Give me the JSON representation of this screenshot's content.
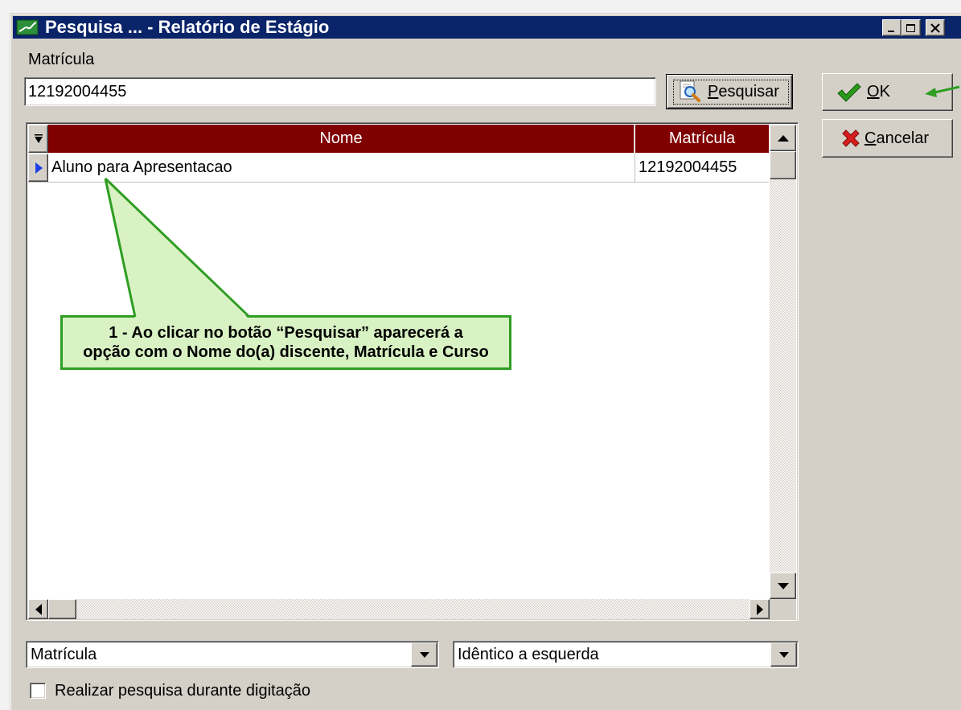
{
  "window": {
    "title": "Pesquisa ... - Relatório de Estágio",
    "icon": "app-icon",
    "controls": [
      "minimize-icon",
      "maximize-icon",
      "close-icon"
    ],
    "title_bar_color": "#0a246a"
  },
  "search": {
    "label": "Matrícula",
    "value": "12192004455",
    "button_label": "Pesquisar",
    "button_icon": "magnifier-icon"
  },
  "actions": {
    "ok_label": "OK",
    "ok_icon": "checkmark-icon",
    "cancel_label": "Cancelar",
    "cancel_icon": "red-x-icon"
  },
  "grid": {
    "header_color": "#800000",
    "indicator_icon": "column-menu-icon",
    "row_indicator_icon": "current-row-arrow-icon",
    "columns": [
      "Nome",
      "Matrícula"
    ],
    "rows": [
      {
        "nome": "Aluno para Apresentacao",
        "matricula": "12192004455",
        "current": true
      }
    ]
  },
  "filters": {
    "field_selected": "Matrícula",
    "mode_selected": "Idêntico a esquerda",
    "live_search_label": "Realizar pesquisa durante digitação",
    "live_search_checked": false
  },
  "annotation": {
    "text": "1 - Ao clicar no botão “Pesquisar” aparecerá a\nopção com o Nome do(a) discente, Matrícula e Curso",
    "border_color": "#2f9e22",
    "fill_color": "#d9f2c4"
  },
  "colors": {
    "dialog_bg": "#d4d0c8"
  }
}
